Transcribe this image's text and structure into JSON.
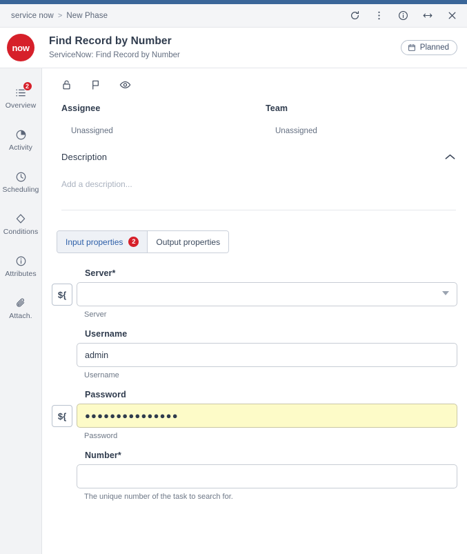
{
  "window": {
    "breadcrumb_root": "service now",
    "breadcrumb_sep": ">",
    "breadcrumb_current": "New Phase",
    "actions": [
      {
        "name": "refresh-icon",
        "title": "Refresh"
      },
      {
        "name": "more-options-icon",
        "title": "More options"
      },
      {
        "name": "info-icon",
        "title": "Info"
      },
      {
        "name": "resize-icon",
        "title": "Resize"
      },
      {
        "name": "close-icon",
        "title": "Close"
      }
    ]
  },
  "header": {
    "logo_text": "now",
    "logo_color": "#d6202a",
    "title": "Find Record by Number",
    "subtitle": "ServiceNow: Find Record by Number",
    "status_label": "Planned",
    "status_icon": "calendar-icon"
  },
  "sidebar": {
    "items": [
      {
        "label": "Overview",
        "icon": "list-icon",
        "badge": "2"
      },
      {
        "label": "Activity",
        "icon": "pie-chart-icon",
        "badge": ""
      },
      {
        "label": "Scheduling",
        "icon": "clock-icon",
        "badge": ""
      },
      {
        "label": "Conditions",
        "icon": "diamond-icon",
        "badge": ""
      },
      {
        "label": "Attributes",
        "icon": "info-circle-icon",
        "badge": ""
      },
      {
        "label": "Attach.",
        "icon": "paperclip-icon",
        "badge": ""
      }
    ]
  },
  "toolbar": {
    "items": [
      {
        "name": "unlock-icon",
        "title": "Lock"
      },
      {
        "name": "flag-icon",
        "title": "Flag"
      },
      {
        "name": "eye-icon",
        "title": "Visibility"
      }
    ]
  },
  "meta": {
    "assignee_label": "Assignee",
    "assignee_value": "Unassigned",
    "team_label": "Team",
    "team_value": "Unassigned"
  },
  "description": {
    "title": "Description",
    "placeholder": "Add a description...",
    "collapse_icon": "chevron-up-icon"
  },
  "tabs": [
    {
      "label": "Input properties",
      "badge": "2",
      "active": true
    },
    {
      "label": "Output properties",
      "badge": "",
      "active": false
    }
  ],
  "form": {
    "fields": [
      {
        "label": "Server",
        "required": true,
        "required_mark": "*",
        "type": "select",
        "value": "",
        "placeholder": "",
        "helper": "Server",
        "has_variable_button": true,
        "variable_button_label": "${",
        "highlighted": false
      },
      {
        "label": "Username",
        "required": false,
        "required_mark": "",
        "type": "text",
        "value": "admin",
        "placeholder": "",
        "helper": "Username",
        "has_variable_button": false,
        "variable_button_label": "",
        "highlighted": false
      },
      {
        "label": "Password",
        "required": false,
        "required_mark": "",
        "type": "password",
        "value": "●●●●●●●●●●●●●●●",
        "placeholder": "",
        "helper": "Password",
        "has_variable_button": true,
        "variable_button_label": "${",
        "highlighted": true
      },
      {
        "label": "Number",
        "required": true,
        "required_mark": "*",
        "type": "text",
        "value": "",
        "placeholder": "",
        "helper": "The unique number of the task to search for.",
        "has_variable_button": false,
        "variable_button_label": "",
        "highlighted": false
      }
    ]
  },
  "colors": {
    "top_strip": "#3a6699",
    "accent_red": "#d6202a",
    "active_tab_text": "#2c5ea8",
    "highlight_field": "#fdfbc8"
  }
}
